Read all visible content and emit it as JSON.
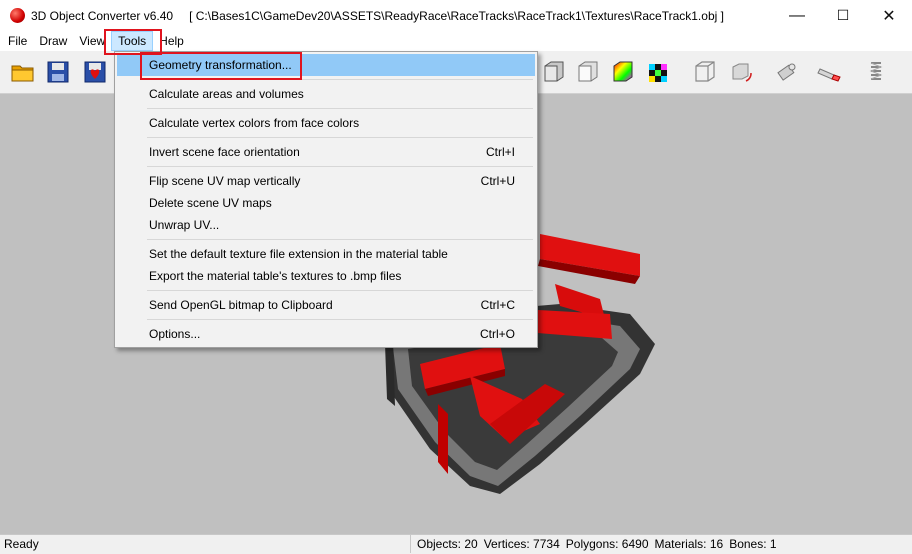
{
  "window": {
    "app_title": "3D Object Converter v6.40",
    "file_path": "[ C:\\Bases1C\\GameDev20\\ASSETS\\ReadyRace\\RaceTracks\\RaceTrack1\\Textures\\RaceTrack1.obj ]",
    "minimize": "—",
    "maximize": "☐",
    "close": "✕"
  },
  "menubar": {
    "items": [
      "File",
      "Draw",
      "View",
      "Tools",
      "Help"
    ],
    "active": "Tools"
  },
  "tools_menu": {
    "items": [
      {
        "label": "Geometry transformation...",
        "shortcut": ""
      },
      {
        "label": "Calculate areas and volumes",
        "shortcut": ""
      },
      {
        "label": "Calculate vertex colors from face colors",
        "shortcut": ""
      },
      {
        "label": "Invert scene face orientation",
        "shortcut": "Ctrl+I"
      },
      {
        "label": "Flip scene UV map vertically",
        "shortcut": "Ctrl+U"
      },
      {
        "label": "Delete scene UV maps",
        "shortcut": ""
      },
      {
        "label": "Unwrap UV...",
        "shortcut": ""
      },
      {
        "label": "Set the default texture file extension in the material table",
        "shortcut": ""
      },
      {
        "label": "Export the material table's textures to .bmp files",
        "shortcut": ""
      },
      {
        "label": "Send OpenGL bitmap to Clipboard",
        "shortcut": "Ctrl+C"
      },
      {
        "label": "Options...",
        "shortcut": "Ctrl+O"
      }
    ]
  },
  "toolbar": {
    "icons": [
      "open-folder-icon",
      "save-icon",
      "save-as-icon",
      "cube-gray-icon",
      "cube-white-icon",
      "cube-color-icon",
      "cube-checker-icon",
      "wireframe-cube-icon",
      "rotate-cube-icon",
      "camera-icon",
      "flashlight-icon",
      "spring-icon"
    ]
  },
  "statusbar": {
    "ready": "Ready",
    "objects": "Objects: 20",
    "vertices": "Vertices: 7734",
    "polygons": "Polygons: 6490",
    "materials": "Materials: 16",
    "bones": "Bones: 1"
  },
  "colors": {
    "viewport": "#c0c0c0",
    "track_red": "#e01010",
    "highlight": "#91c9f7",
    "callout": "#e0141e"
  }
}
